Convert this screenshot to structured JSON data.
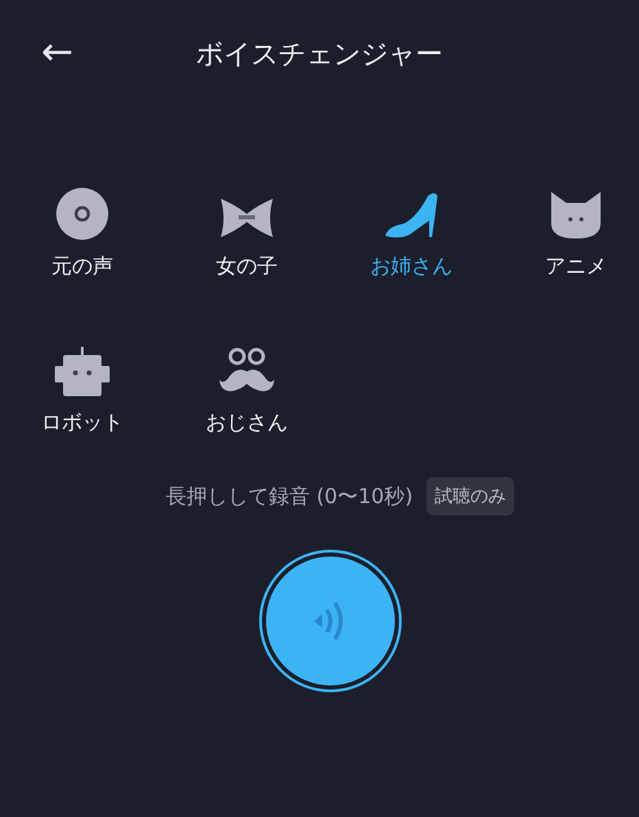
{
  "header": {
    "back": "←",
    "title": "ボイスチェンジャー"
  },
  "voices": [
    {
      "kind": "disc",
      "label": "元の声",
      "selected": false
    },
    {
      "kind": "bow",
      "label": "女の子",
      "selected": false
    },
    {
      "kind": "heel",
      "label": "お姉さん",
      "selected": true
    },
    {
      "kind": "cat",
      "label": "アニメ",
      "selected": false
    },
    {
      "kind": "robot",
      "label": "ロボット",
      "selected": false
    },
    {
      "kind": "mustache",
      "label": "おじさん",
      "selected": false
    }
  ],
  "hint": {
    "text": "長押しして録音 (0〜10秒)",
    "badge": "試聴のみ"
  }
}
